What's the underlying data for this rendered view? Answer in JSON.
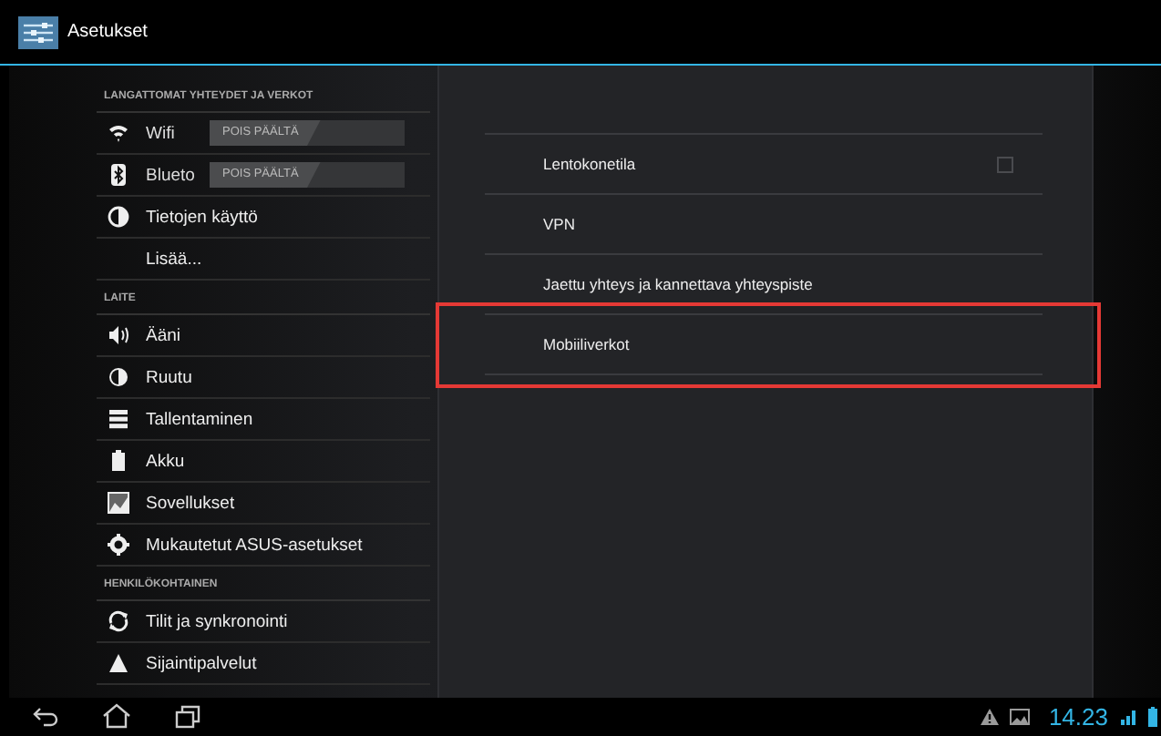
{
  "window": {
    "title": "Asetukset"
  },
  "sidebar": {
    "sections": [
      {
        "header": "LANGATTOMAT YHTEYDET JA VERKOT",
        "items": [
          {
            "kind": "toggle",
            "label": "Wifi",
            "toggle": {
              "label": "POIS PÄÄLTÄ",
              "on": false
            }
          },
          {
            "kind": "toggle",
            "label": "Blueto",
            "toggle": {
              "label": "POIS PÄÄLTÄ",
              "on": false
            }
          },
          {
            "kind": "plain",
            "label": "Tietojen käyttö"
          },
          {
            "kind": "plain",
            "label": "Lisää..."
          }
        ]
      },
      {
        "header": "LAITE",
        "items": [
          {
            "kind": "plain",
            "label": "Ääni"
          },
          {
            "kind": "plain",
            "label": "Ruutu"
          },
          {
            "kind": "plain",
            "label": "Tallentaminen"
          },
          {
            "kind": "plain",
            "label": "Akku"
          },
          {
            "kind": "plain",
            "label": "Sovellukset"
          },
          {
            "kind": "plain",
            "label": "Mukautetut ASUS-asetukset"
          }
        ]
      },
      {
        "header": "HENKILÖKOHTAINEN",
        "items": [
          {
            "kind": "plain",
            "label": "Tilit ja synkronointi"
          },
          {
            "kind": "plain",
            "label": "Sijaintipalvelut"
          }
        ]
      }
    ]
  },
  "detail": {
    "items": [
      {
        "kind": "checkbox",
        "label": "Lentokonetila",
        "checked": false,
        "highlighted": false
      },
      {
        "kind": "plain",
        "label": "VPN",
        "highlighted": false
      },
      {
        "kind": "plain",
        "label": "Jaettu yhteys ja kannettava yhteyspiste",
        "highlighted": false
      },
      {
        "kind": "plain",
        "label": "Mobiiliverkot",
        "highlighted": true
      }
    ]
  },
  "status_bar": {
    "time": "14.23"
  }
}
